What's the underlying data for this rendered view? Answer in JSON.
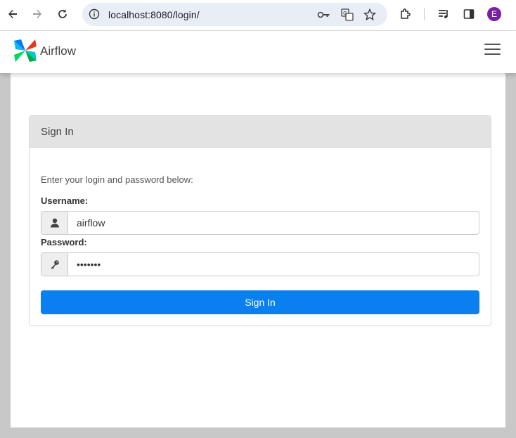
{
  "browser": {
    "url": "localhost:8080/login/",
    "profile_initial": "E",
    "avatar_color": "#7b1fa2"
  },
  "navbar": {
    "brand_name": "Airflow"
  },
  "login": {
    "heading": "Sign In",
    "intro": "Enter your login and password below:",
    "username_label": "Username:",
    "username_value": "airflow",
    "password_label": "Password:",
    "password_value": "airflow",
    "submit_label": "Sign In"
  },
  "colors": {
    "primary_button": "#0a7ff0",
    "panel_heading_bg": "#e3e3e3"
  },
  "icons": [
    "back-arrow-icon",
    "forward-arrow-icon",
    "reload-icon",
    "info-icon",
    "key-icon",
    "translate-icon",
    "star-icon",
    "extensions-icon",
    "media-icon",
    "side-panel-icon",
    "user-icon",
    "key-icon"
  ]
}
